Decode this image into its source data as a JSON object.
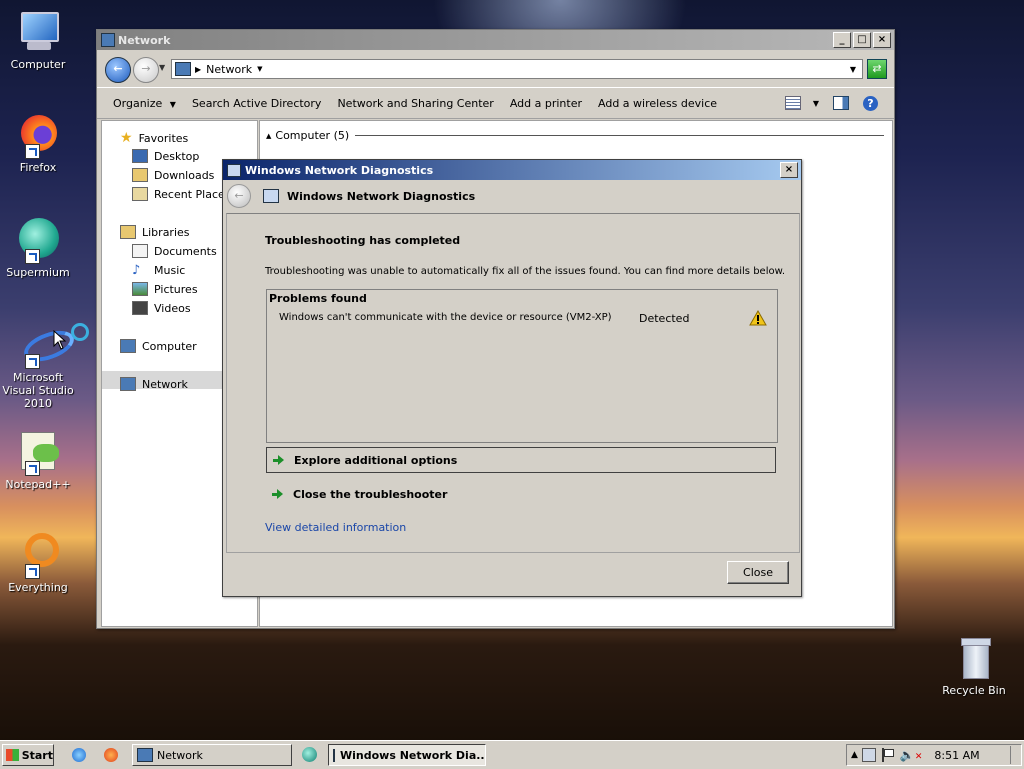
{
  "desktop": {
    "icons": [
      {
        "label": "Computer"
      },
      {
        "label": "Firefox"
      },
      {
        "label": "Supermium"
      },
      {
        "label": "Microsoft Visual Studio 2010"
      },
      {
        "label": "Notepad++"
      },
      {
        "label": "Everything"
      },
      {
        "label": "Recycle Bin"
      }
    ]
  },
  "explorer": {
    "title": "Network",
    "address": "Network",
    "toolbar": {
      "organize": "Organize",
      "search_ad": "Search Active Directory",
      "network_sharing": "Network and Sharing Center",
      "add_printer": "Add a printer",
      "add_wireless": "Add a wireless device"
    },
    "nav": {
      "favorites": "Favorites",
      "desktop": "Desktop",
      "downloads": "Downloads",
      "recent_places": "Recent Places",
      "libraries": "Libraries",
      "documents": "Documents",
      "music": "Music",
      "pictures": "Pictures",
      "videos": "Videos",
      "computer": "Computer",
      "network": "Network"
    },
    "group_header": "Computer (5)"
  },
  "dialog": {
    "title": "Windows Network Diagnostics",
    "header": "Windows Network Diagnostics",
    "heading": "Troubleshooting has completed",
    "message": "Troubleshooting was unable to automatically fix all of the issues found. You can find more details below.",
    "problems_title": "Problems found",
    "problem": {
      "text": "Windows can't communicate with the device or resource (VM2-XP)",
      "status": "Detected"
    },
    "option_explore": "Explore additional options",
    "option_close": "Close the troubleshooter",
    "details_link": "View detailed information",
    "close_button": "Close"
  },
  "taskbar": {
    "start": "Start",
    "network_task": "Network",
    "diag_task": "Windows Network Dia...",
    "clock": "8:51 AM"
  },
  "colors": {
    "titlebar_active": "#0a246a",
    "link": "#1a46a8",
    "arrow": "#1c8f2a",
    "warning": "#f0c419"
  }
}
